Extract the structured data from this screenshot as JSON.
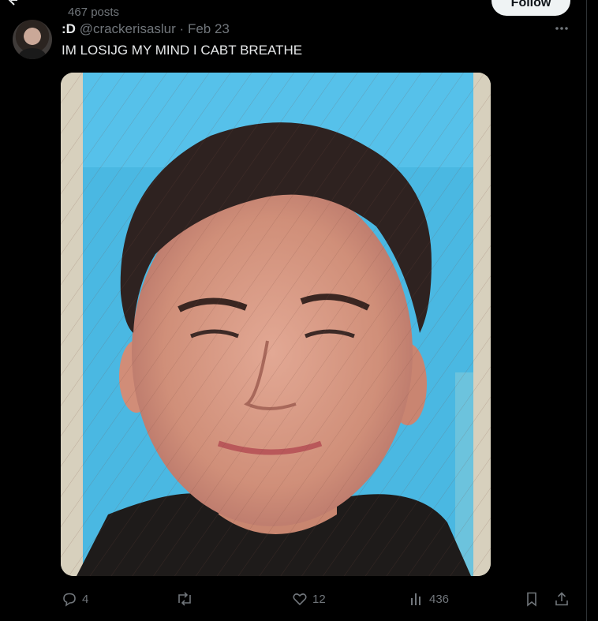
{
  "header": {
    "post_count": "467 posts",
    "follow_label": "Follow"
  },
  "tweet": {
    "display_name": ":D",
    "handle": "@crackerisaslur",
    "separator": "·",
    "date": "Feb 23",
    "text": "IM LOSIJG MY MIND I CABT BREATHE"
  },
  "actions": {
    "replies": "4",
    "reposts": "",
    "likes": "12",
    "views": "436"
  },
  "icons": {
    "back": "back-arrow-icon",
    "more": "more-dots-icon",
    "reply": "reply-icon",
    "repost": "repost-icon",
    "like": "heart-icon",
    "views": "views-chart-icon",
    "bookmark": "bookmark-icon",
    "share": "share-icon"
  },
  "colors": {
    "background": "#000000",
    "text": "#e7e9ea",
    "muted": "#71767b",
    "follow_bg": "#eff3f4",
    "photo_blue": "#4ab8e2"
  }
}
